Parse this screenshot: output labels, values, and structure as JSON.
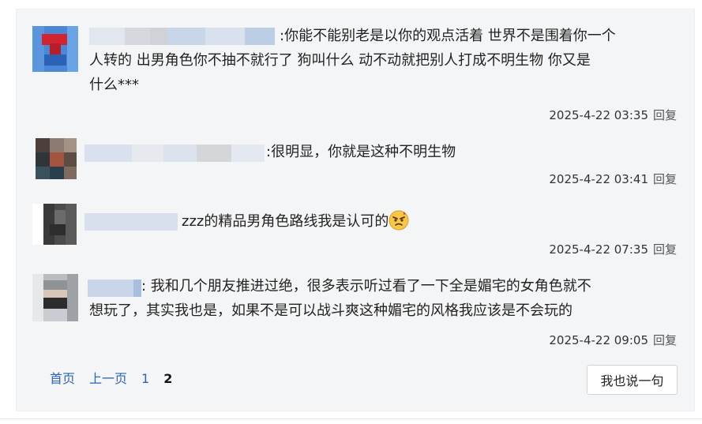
{
  "replies": [
    {
      "text_lines": [
        ":你能不能别老是以你的观点活着 世界不是围着你一个",
        "人转的 出男角色你不抽不就行了 狗叫什么 动不动就把别人打成不明生物 你又是",
        "什么***"
      ],
      "time": "2025-4-22 03:35",
      "reply_label": "回复"
    },
    {
      "text_lines": [
        ":很明显，你就是这种不明生物"
      ],
      "time": "2025-4-22 03:41",
      "reply_label": "回复"
    },
    {
      "text_lines": [
        "zzz的精品男角色路线我是认可的"
      ],
      "time": "2025-4-22 07:35",
      "reply_label": "回复",
      "emoji_icon": "angry-face-emoji"
    },
    {
      "text_lines": [
        ": 我和几个朋友推进过绝，很多表示听过看了一下全是媚宅的女角色就不",
        "想玩了，其实我也是，如果不是可以战斗爽这种媚宅的风格我应该是不会玩的"
      ],
      "time": "2025-4-22 09:05",
      "reply_label": "回复"
    }
  ],
  "pager": {
    "first": "首页",
    "prev": "上一页",
    "pages": [
      "1",
      "2"
    ],
    "current": "2"
  },
  "say_button": "我也说一句",
  "colors": {
    "link": "#2d64b3",
    "panel_bg": "#f4f5f7"
  }
}
